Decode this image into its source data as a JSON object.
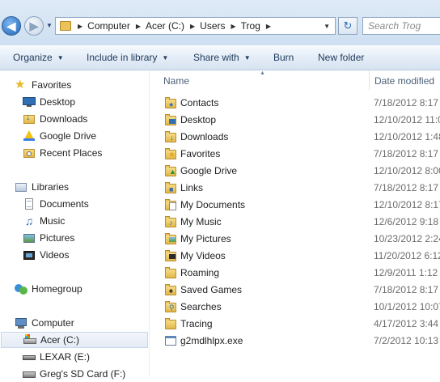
{
  "address": {
    "crumbs": [
      "Computer",
      "Acer (C:)",
      "Users",
      "Trog"
    ]
  },
  "search": {
    "placeholder": "Search Trog"
  },
  "toolbar": {
    "organize": "Organize",
    "include_in_library": "Include in library",
    "share_with": "Share with",
    "burn": "Burn",
    "new_folder": "New folder"
  },
  "nav": {
    "favorites": "Favorites",
    "favorites_items": [
      "Desktop",
      "Downloads",
      "Google Drive",
      "Recent Places"
    ],
    "libraries": "Libraries",
    "libraries_items": [
      "Documents",
      "Music",
      "Pictures",
      "Videos"
    ],
    "homegroup": "Homegroup",
    "computer": "Computer",
    "computer_items": [
      "Acer (C:)",
      "LEXAR (E:)",
      "Greg's SD Card (F:)"
    ]
  },
  "columns": {
    "name": "Name",
    "date": "Date modified"
  },
  "files": [
    {
      "name": "Contacts",
      "date": "7/18/2012 8:17 A",
      "icon": "contacts-folder-icon"
    },
    {
      "name": "Desktop",
      "date": "12/10/2012 11:0",
      "icon": "desktop-folder-icon"
    },
    {
      "name": "Downloads",
      "date": "12/10/2012 1:48",
      "icon": "downloads-folder-icon"
    },
    {
      "name": "Favorites",
      "date": "7/18/2012 8:17 A",
      "icon": "favorites-folder-icon"
    },
    {
      "name": "Google Drive",
      "date": "12/10/2012 8:00",
      "icon": "google-drive-folder-icon"
    },
    {
      "name": "Links",
      "date": "7/18/2012 8:17 A",
      "icon": "links-folder-icon"
    },
    {
      "name": "My Documents",
      "date": "12/10/2012 8:17",
      "icon": "documents-folder-icon"
    },
    {
      "name": "My Music",
      "date": "12/6/2012 9:18 I",
      "icon": "music-folder-icon"
    },
    {
      "name": "My Pictures",
      "date": "10/23/2012 2:24",
      "icon": "pictures-folder-icon"
    },
    {
      "name": "My Videos",
      "date": "11/20/2012 6:12",
      "icon": "videos-folder-icon"
    },
    {
      "name": "Roaming",
      "date": "12/9/2011 1:12 A",
      "icon": "folder-icon"
    },
    {
      "name": "Saved Games",
      "date": "7/18/2012 8:17 A",
      "icon": "saved-games-folder-icon"
    },
    {
      "name": "Searches",
      "date": "10/1/2012 10:07",
      "icon": "searches-folder-icon"
    },
    {
      "name": "Tracing",
      "date": "4/17/2012 3:44 I",
      "icon": "folder-icon"
    },
    {
      "name": "g2mdlhlpx.exe",
      "date": "7/2/2012 10:13",
      "icon": "exe-file-icon"
    }
  ],
  "colors": {
    "accent": "#1f63b6",
    "folder": "#e2b84a",
    "command_text": "#1e395b",
    "selection": "#e3ebf5"
  }
}
